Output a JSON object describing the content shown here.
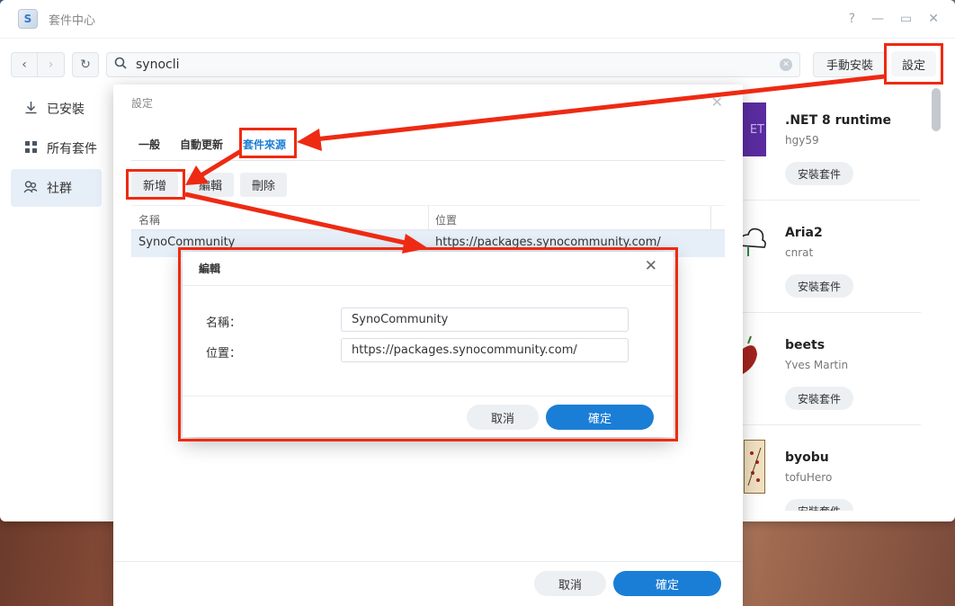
{
  "window": {
    "title": "套件中心",
    "help_glyph": "?",
    "minimize_glyph": "—",
    "maximize_glyph": "▭",
    "close_glyph": "✕"
  },
  "toolbar": {
    "search_value": "synocli",
    "manual_install_label": "手動安裝",
    "settings_label": "設定"
  },
  "sidebar": {
    "items": [
      {
        "label": "已安裝",
        "icon": "download-icon"
      },
      {
        "label": "所有套件",
        "icon": "grid-icon"
      },
      {
        "label": "社群",
        "icon": "community-icon",
        "active": true
      }
    ]
  },
  "packages": [
    {
      "name": ".NET 8 runtime",
      "author": "hgy59",
      "install_label": "安裝套件",
      "thumb_text": "ET"
    },
    {
      "name": "Aria2",
      "author": "cnrat",
      "install_label": "安裝套件"
    },
    {
      "name": "beets",
      "author": "Yves Martin",
      "install_label": "安裝套件"
    },
    {
      "name": "byobu",
      "author": "tofuHero",
      "install_label": "安裝套件"
    }
  ],
  "settings_dialog": {
    "title": "設定",
    "tabs": [
      "一般",
      "自動更新",
      "套件來源"
    ],
    "active_tab": "套件來源",
    "buttons": {
      "add": "新增",
      "edit": "編輯",
      "delete": "刪除"
    },
    "columns": {
      "name": "名稱",
      "location": "位置"
    },
    "rows": [
      {
        "name": "SynoCommunity",
        "location": "https://packages.synocommunity.com/"
      }
    ],
    "cancel_label": "取消",
    "ok_label": "確定"
  },
  "edit_dialog": {
    "title": "編輯",
    "name_label": "名稱：",
    "name_value": "SynoCommunity",
    "location_label": "位置：",
    "location_value": "https://packages.synocommunity.com/",
    "cancel_label": "取消",
    "ok_label": "確定"
  },
  "colors": {
    "accent": "#1b7ed6",
    "highlight": "#ee2a13"
  }
}
